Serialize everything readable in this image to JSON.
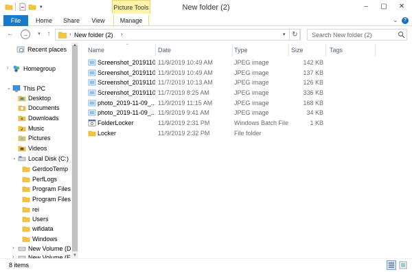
{
  "window": {
    "title": "New folder (2)",
    "context_tab": "Picture Tools"
  },
  "ribbon": {
    "tabs": [
      "File",
      "Home",
      "Share",
      "View",
      "Manage"
    ]
  },
  "navigation": {
    "path": [
      "New folder (2)"
    ],
    "search_placeholder": "Search New folder (2)"
  },
  "sidebar": {
    "items": [
      {
        "label": "Recent places",
        "icon": "recent-places-icon"
      },
      {
        "label": "Homegroup",
        "icon": "homegroup-icon"
      },
      {
        "label": "This PC",
        "icon": "this-pc-icon"
      },
      {
        "label": "Desktop",
        "icon": "desktop-icon"
      },
      {
        "label": "Documents",
        "icon": "documents-icon"
      },
      {
        "label": "Downloads",
        "icon": "downloads-icon"
      },
      {
        "label": "Music",
        "icon": "music-icon"
      },
      {
        "label": "Pictures",
        "icon": "pictures-icon"
      },
      {
        "label": "Videos",
        "icon": "videos-icon"
      },
      {
        "label": "Local Disk (C:)",
        "icon": "drive-icon"
      },
      {
        "label": "GerdooTemp",
        "icon": "folder-icon"
      },
      {
        "label": "PerfLogs",
        "icon": "folder-icon"
      },
      {
        "label": "Program Files",
        "icon": "folder-icon"
      },
      {
        "label": "Program Files (",
        "icon": "folder-icon"
      },
      {
        "label": "rei",
        "icon": "folder-icon"
      },
      {
        "label": "Users",
        "icon": "folder-icon"
      },
      {
        "label": "wifidata",
        "icon": "folder-icon"
      },
      {
        "label": "Windows",
        "icon": "folder-icon"
      },
      {
        "label": "New Volume (D:)",
        "icon": "drive-icon"
      },
      {
        "label": "New Volume (E:)",
        "icon": "drive-icon"
      }
    ]
  },
  "filelist": {
    "columns": [
      "Name",
      "Date",
      "Type",
      "Size",
      "Tags"
    ],
    "rows": [
      {
        "name": "Screenshot_2019110...",
        "date": "11/9/2019 10:49 AM",
        "type": "JPEG image",
        "size": "142 KB",
        "icon": "jpeg-image-icon"
      },
      {
        "name": "Screenshot_2019110...",
        "date": "11/9/2019 10:49 AM",
        "type": "JPEG image",
        "size": "137 KB",
        "icon": "jpeg-image-icon"
      },
      {
        "name": "Screenshot_2019110...",
        "date": "11/7/2019 10:13 AM",
        "type": "JPEG image",
        "size": "126 KB",
        "icon": "jpeg-image-icon"
      },
      {
        "name": "Screenshot_2019110...",
        "date": "11/7/2019 8:25 AM",
        "type": "JPEG image",
        "size": "336 KB",
        "icon": "jpeg-image-icon"
      },
      {
        "name": "photo_2019-11-09_...",
        "date": "11/9/2019 11:15 AM",
        "type": "JPEG image",
        "size": "168 KB",
        "icon": "jpeg-image-icon"
      },
      {
        "name": "photo_2019-11-09_...",
        "date": "11/9/2019 9:41 AM",
        "type": "JPEG image",
        "size": "34 KB",
        "icon": "jpeg-image-icon"
      },
      {
        "name": "FolderLocker",
        "date": "11/9/2019 2:31 PM",
        "type": "Windows Batch File",
        "size": "1 KB",
        "icon": "batch-file-icon"
      },
      {
        "name": "Locker",
        "date": "11/9/2019 2:32 PM",
        "type": "File folder",
        "size": "",
        "icon": "folder-icon"
      }
    ]
  },
  "status": {
    "item_count": "8 items"
  },
  "colors": {
    "accent": "#1979ca",
    "context_tab": "#fdf3a8",
    "folder": "#f5c542"
  }
}
